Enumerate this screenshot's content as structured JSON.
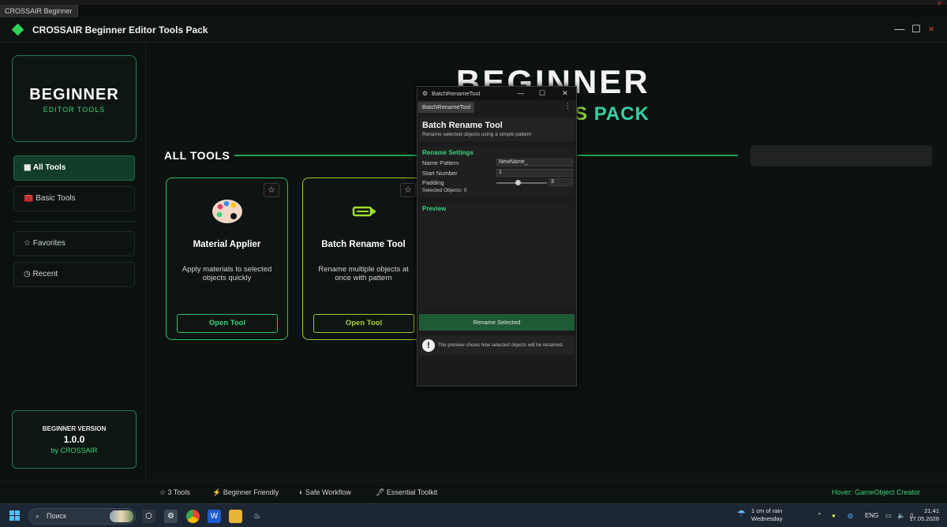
{
  "os": {
    "app_tab": "CROSSAIR Beginner",
    "taskbar": {
      "search_placeholder": "Поиск",
      "weather_line1": "1 cm of rain",
      "weather_line2": "Wednesday",
      "lang": "ENG",
      "time": "21:41",
      "date": "17.05.2026"
    }
  },
  "app": {
    "title": "CROSSAIR Beginner Editor Tools Pack",
    "accent": "#2fd35a",
    "window_controls": {
      "minimize": "—",
      "maximize": "☐",
      "close": "×"
    }
  },
  "sidebar": {
    "brand_title": "BEGINNER",
    "brand_subtitle": "EDITOR TOOLS",
    "items": [
      {
        "label": "▦ All Tools",
        "active": true
      },
      {
        "label": "🧰 Basic Tools",
        "active": false
      },
      {
        "label": "☆ Favorites",
        "active": false
      },
      {
        "label": "◷ Recent",
        "active": false
      }
    ],
    "version_label": "BEGINNER VERSION",
    "version_number": "1.0.0",
    "version_by": "by CROSSAIR"
  },
  "main": {
    "hero_line1": "BEGINNER",
    "hero_line2_a": "S",
    "hero_line2_b": "PACK",
    "section_title": "ALL TOOLS",
    "cards": [
      {
        "name": "Material Applier",
        "description": "Apply materials to selected objects quickly",
        "button": "Open Tool",
        "star": "☆",
        "icon": "palette-icon"
      },
      {
        "name": "Batch Rename Tool",
        "description": "Rename multiple objects at once with pattern",
        "button": "Open Tool",
        "star": "☆",
        "icon": "pencil-icon"
      }
    ]
  },
  "footer": {
    "items": [
      "☆ 3 Tools",
      "⚡ Beginner Friendly",
      "◐ Safe Workflow",
      "🖋 Essential Toolkit"
    ],
    "hover_status": "Hover: GameObject Creator"
  },
  "tool_window": {
    "title": "BatchRenameTool",
    "tab": "BatchRenameTool",
    "header_title": "Batch Rename Tool",
    "header_subtitle": "Rename selected objects using a simple pattern",
    "settings_title": "Rename Settings",
    "name_pattern_label": "Name Pattern",
    "name_pattern_value": "NewName_",
    "start_number_label": "Start Number",
    "start_number_value": "1",
    "padding_label": "Padding",
    "padding_value": "3",
    "selected_objects": "Selected Objects: 0",
    "preview_title": "Preview",
    "rename_button": "Rename Selected",
    "info_text": "The preview shows how selected objects will be renamed."
  }
}
